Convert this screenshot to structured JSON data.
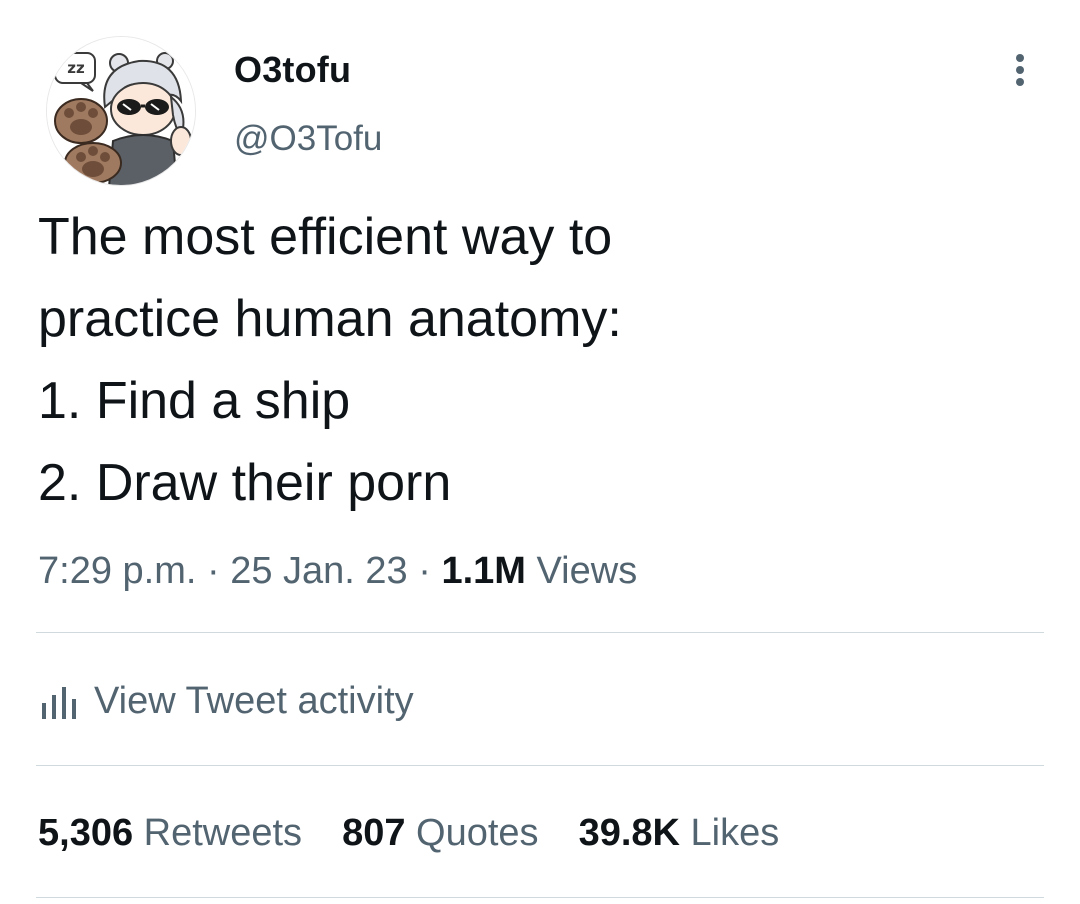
{
  "author": {
    "display_name": "O3tofu",
    "handle": "@O3Tofu",
    "avatar_icon": "chibi-character-avatar",
    "avatar_badge": "zz"
  },
  "tweet": {
    "lines": [
      "The most efficient way to",
      "practice human anatomy:",
      "1. Find a ship",
      "2. Draw their porn"
    ]
  },
  "meta": {
    "time": "7:29 p.m.",
    "separator": "·",
    "date": "25 Jan. 23",
    "views_count": "1.1M",
    "views_label": "Views"
  },
  "activity": {
    "label": "View Tweet activity",
    "icon": "bar-chart-icon"
  },
  "stats": {
    "retweets_count": "5,306",
    "retweets_label": "Retweets",
    "quotes_count": "807",
    "quotes_label": "Quotes",
    "likes_count": "39.8K",
    "likes_label": "Likes"
  },
  "colors": {
    "text_primary": "#0f1419",
    "text_secondary": "#536471",
    "divider": "#cfd9de",
    "background": "#ffffff"
  }
}
